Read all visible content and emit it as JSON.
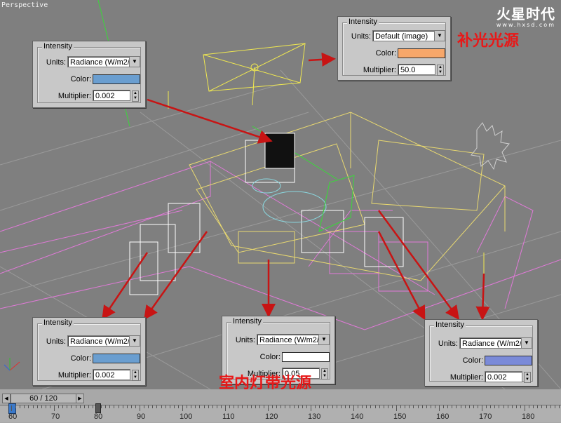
{
  "viewport": {
    "label": "Perspective"
  },
  "watermark": {
    "logo": "火星时代",
    "site": "www.hxsd.com"
  },
  "panels": {
    "fill_light": {
      "group": "Intensity",
      "units_label": "Units:",
      "units_value": "Default (image)",
      "color_label": "Color:",
      "color": "#f7a76a",
      "multiplier_label": "Multiplier:",
      "multiplier": "50.0"
    },
    "top_left": {
      "group": "Intensity",
      "units_label": "Units:",
      "units_value": "Radiance (W/m2/",
      "color_label": "Color:",
      "color": "#6a9ed0",
      "multiplier_label": "Multiplier:",
      "multiplier": "0.002"
    },
    "bottom_left": {
      "group": "Intensity",
      "units_label": "Units:",
      "units_value": "Radiance (W/m2/",
      "color_label": "Color:",
      "color": "#6a9ed0",
      "multiplier_label": "Multiplier:",
      "multiplier": "0.002"
    },
    "bottom_center": {
      "group": "Intensity",
      "units_label": "Units:",
      "units_value": "Radiance (W/m2/",
      "color_label": "Color:",
      "color": "#ffffff",
      "multiplier_label": "Multiplier:",
      "multiplier": "0.05"
    },
    "bottom_right": {
      "group": "Intensity",
      "units_label": "Units:",
      "units_value": "Radiance (W/m2/",
      "color_label": "Color:",
      "color": "#7a8ad8",
      "multiplier_label": "Multiplier:",
      "multiplier": "0.002"
    }
  },
  "annotations": {
    "fill_light_source": "补光光源",
    "indoor_strip_light_source": "室内灯带光源"
  },
  "timeline": {
    "frame_counter": "60 / 120",
    "current_frame": 60,
    "total_frames": 120,
    "ticks": [
      "60",
      "70",
      "80",
      "90",
      "100",
      "110",
      "120",
      "130",
      "140",
      "150",
      "160",
      "170",
      "180"
    ]
  },
  "colors": {
    "arrow": "#c81414",
    "annotation_text": "#e81818",
    "viewport_bg": "#7f7f7f"
  }
}
